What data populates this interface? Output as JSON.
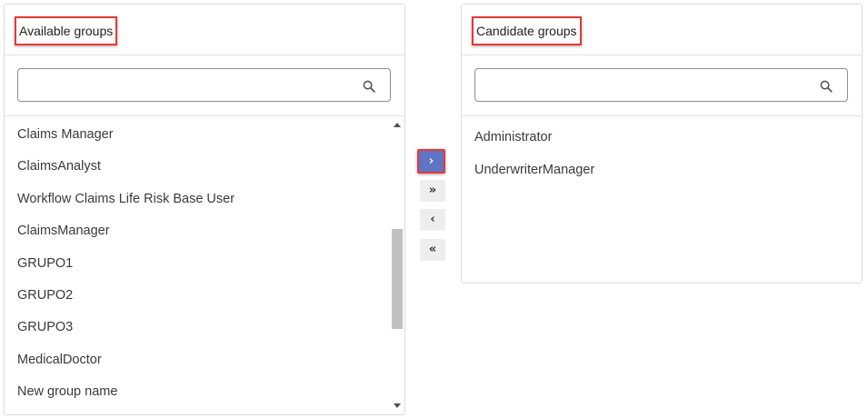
{
  "available": {
    "title": "Available groups",
    "search": {
      "value": "",
      "placeholder": "",
      "icon": "search-icon"
    },
    "items": [
      {
        "label": "Claims Manager"
      },
      {
        "label": "ClaimsAnalyst"
      },
      {
        "label": "Workflow Claims Life Risk Base User"
      },
      {
        "label": "ClaimsManager"
      },
      {
        "label": "GRUPO1"
      },
      {
        "label": "GRUPO2"
      },
      {
        "label": "GRUPO3"
      },
      {
        "label": "MedicalDoctor"
      },
      {
        "label": "New group name"
      }
    ]
  },
  "candidate": {
    "title": "Candidate groups",
    "search": {
      "value": "",
      "placeholder": "",
      "icon": "search-icon"
    },
    "items": [
      {
        "label": "Administrator"
      },
      {
        "label": "UnderwriterManager"
      }
    ]
  },
  "transfer": {
    "move_right": "›",
    "move_all_right": "»",
    "move_left": "‹",
    "move_all_left": "«"
  },
  "colors": {
    "highlight_border": "#e53935",
    "active_button": "#5f74c4",
    "button_bg": "#eeeeee"
  }
}
